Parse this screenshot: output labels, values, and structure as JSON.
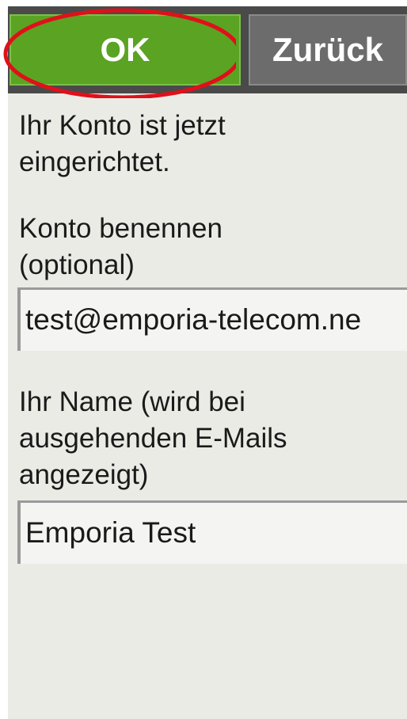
{
  "toolbar": {
    "ok_label": "OK",
    "back_label": "Zurück"
  },
  "messages": {
    "account_ready": "Ihr Konto ist jetzt eingerichtet."
  },
  "account_name": {
    "label": "Konto benennen (optional)",
    "value": "test@emporia-telecom.ne"
  },
  "your_name": {
    "label": "Ihr Name (wird bei ausgehenden E-Mails angezeigt)",
    "value": "Emporia Test"
  },
  "colors": {
    "ok_button": "#5ba323",
    "back_button": "#6c6c6c",
    "highlight_ring": "#e0101a",
    "background": "#ebebe6"
  }
}
